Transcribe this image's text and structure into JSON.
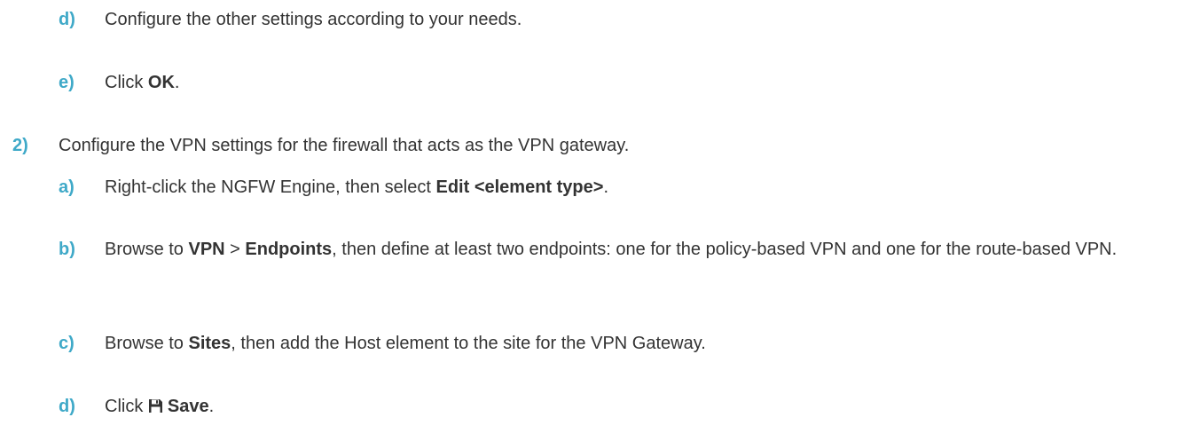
{
  "steps": {
    "s1d": {
      "num": "d)",
      "text": "Configure the other settings according to your needs."
    },
    "s1e": {
      "num": "e)",
      "pre": "Click ",
      "b1": "OK",
      "post": "."
    },
    "s2": {
      "num": "2)",
      "text": "Configure the VPN settings for the firewall that acts as the VPN gateway."
    },
    "s2a": {
      "num": "a)",
      "pre": "Right-click the NGFW Engine, then select ",
      "b1": "Edit <element type>",
      "post": "."
    },
    "s2b": {
      "num": "b)",
      "pre": "Browse to ",
      "b1": "VPN",
      "mid": " > ",
      "b2": "Endpoints",
      "post": ", then define at least two endpoints: one for the policy-based VPN and one for the route-based VPN."
    },
    "s2c": {
      "num": "c)",
      "pre": "Browse to ",
      "b1": "Sites",
      "post": ", then add the Host element to the site for the VPN Gateway."
    },
    "s2d": {
      "num": "d)",
      "pre": "Click ",
      "icon": "save-icon",
      "b1": "Save",
      "post": "."
    }
  }
}
